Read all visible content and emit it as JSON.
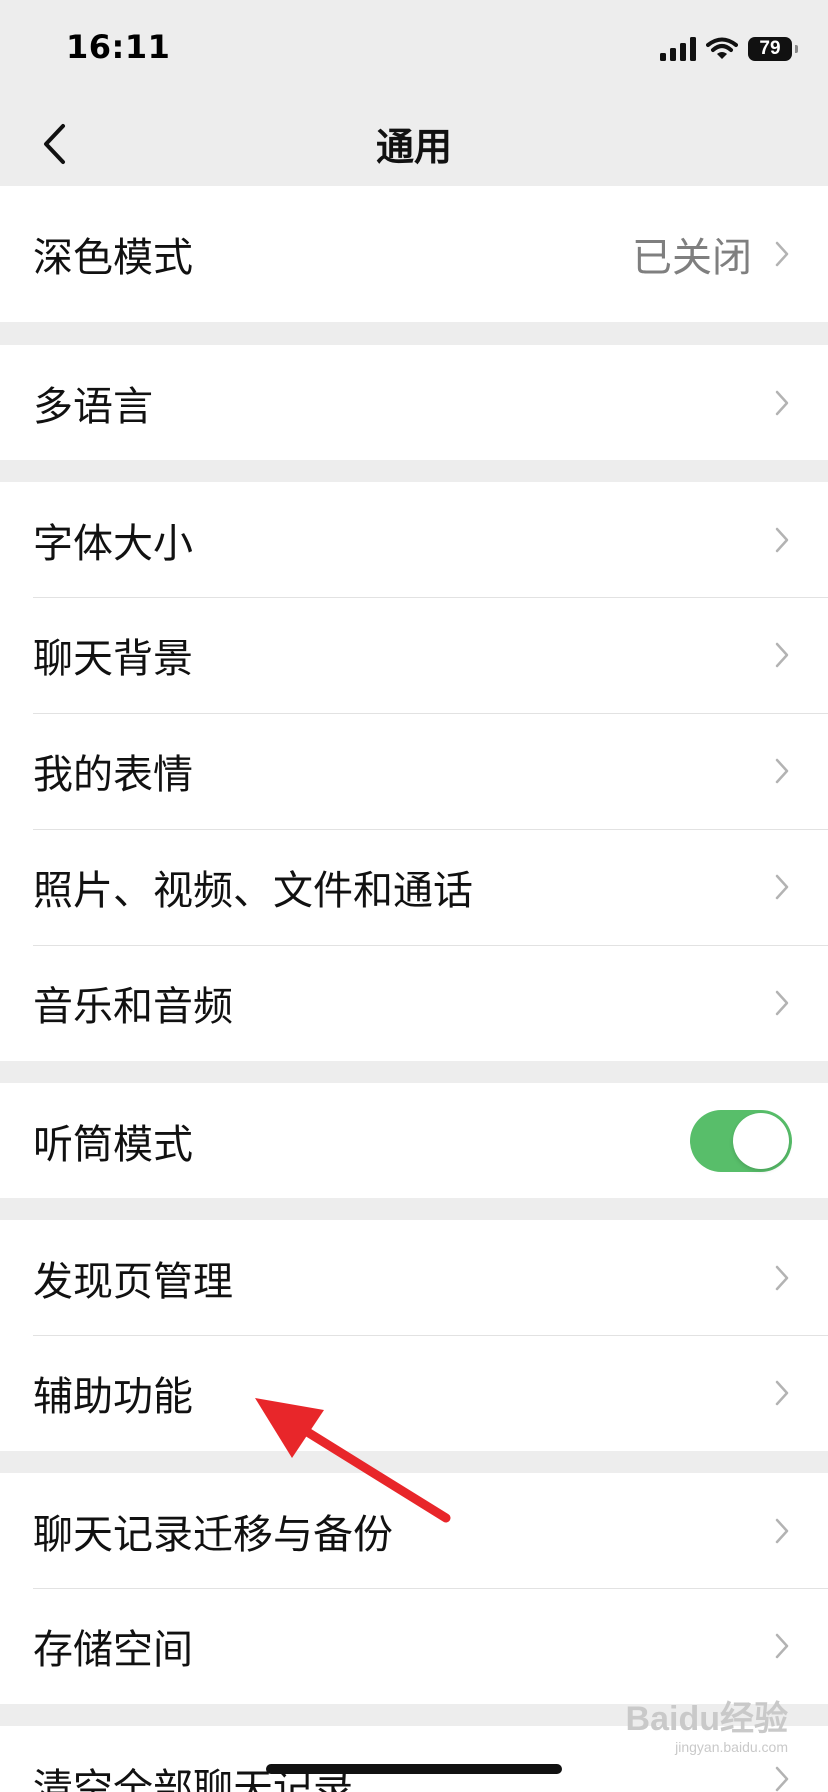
{
  "status_bar": {
    "time": "16:11",
    "battery": "79",
    "icons": [
      "signal-icon",
      "wifi-icon",
      "battery-icon"
    ]
  },
  "nav": {
    "title": "通用",
    "back_icon": "chevron-left-icon"
  },
  "groups": [
    {
      "rows": [
        {
          "label": "深色模式",
          "value": "已关闭"
        }
      ]
    },
    {
      "rows": [
        {
          "label": "多语言"
        }
      ]
    },
    {
      "rows": [
        {
          "label": "字体大小"
        },
        {
          "label": "聊天背景"
        },
        {
          "label": "我的表情"
        },
        {
          "label": "照片、视频、文件和通话"
        },
        {
          "label": "音乐和音频"
        }
      ]
    },
    {
      "rows": [
        {
          "label": "听筒模式",
          "toggle_on": true
        }
      ]
    },
    {
      "rows": [
        {
          "label": "发现页管理"
        },
        {
          "label": "辅助功能"
        }
      ]
    },
    {
      "rows": [
        {
          "label": "聊天记录迁移与备份"
        },
        {
          "label": "存储空间"
        }
      ]
    },
    {
      "rows": [
        {
          "label": "清空全部聊天记录"
        }
      ]
    }
  ],
  "colors": {
    "background": "#ededed",
    "toggle_on": "#58be6a",
    "annotation_arrow": "#e8262a"
  },
  "watermark": {
    "text": "Baidu经验",
    "sub": "jingyan.baidu.com"
  }
}
